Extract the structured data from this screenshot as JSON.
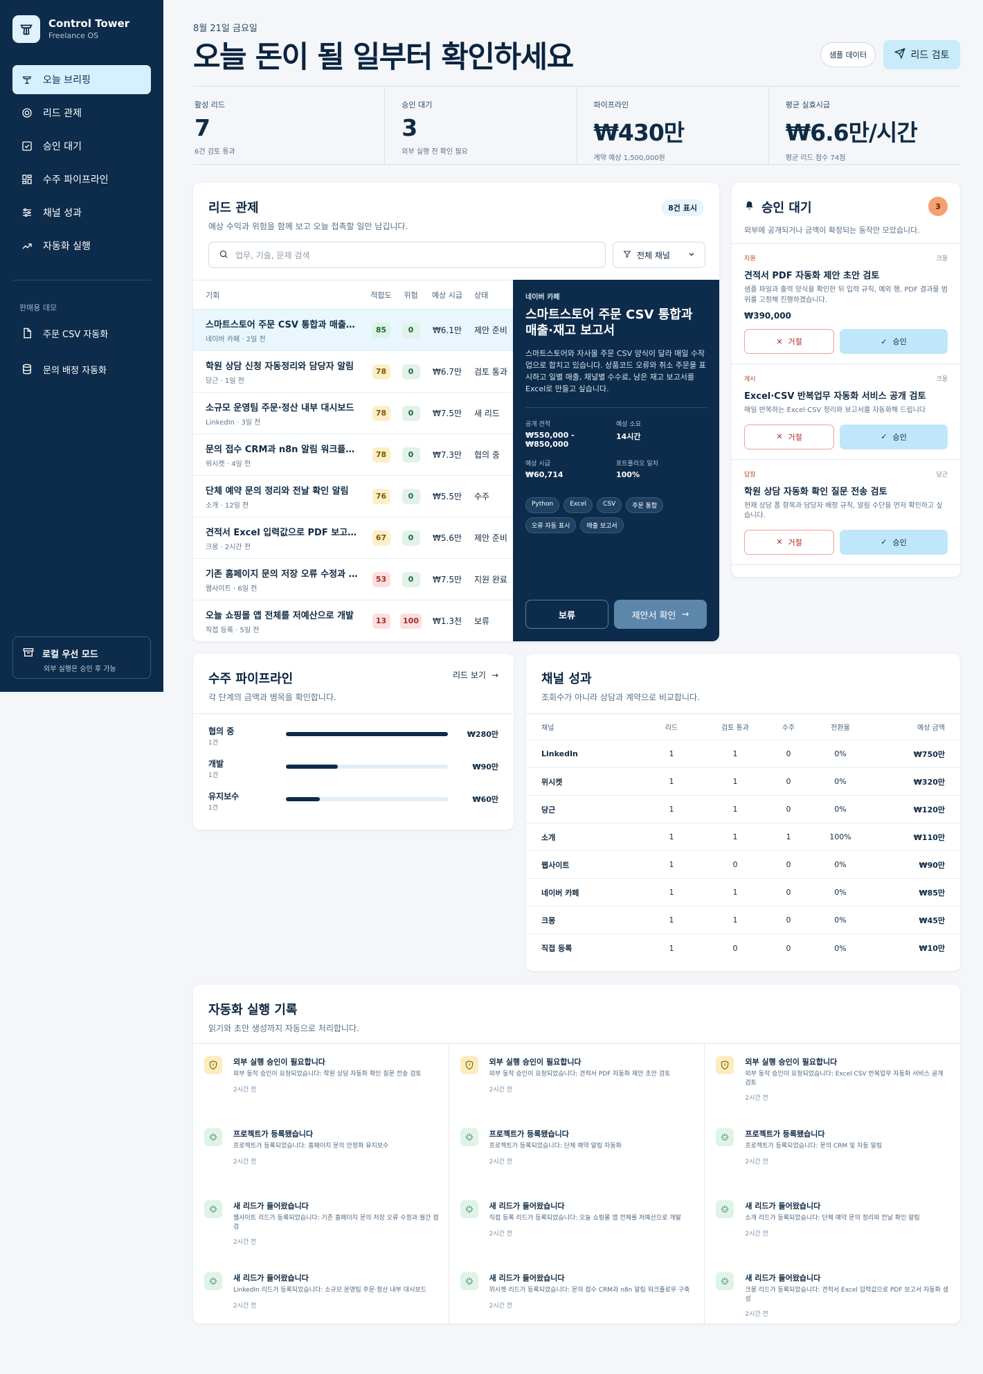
{
  "brand": {
    "title": "Control Tower",
    "subtitle": "Freelance OS"
  },
  "nav": [
    {
      "label": "오늘 브리핑",
      "icon": "tower-icon",
      "active": true
    },
    {
      "label": "리드 관제",
      "icon": "target-icon"
    },
    {
      "label": "승인 대기",
      "icon": "check-square-icon"
    },
    {
      "label": "수주 파이프라인",
      "icon": "kanban-icon"
    },
    {
      "label": "채널 성과",
      "icon": "sliders-icon"
    },
    {
      "label": "자동화 실행",
      "icon": "trend-icon"
    }
  ],
  "demo_section": "판매용 데모",
  "demo_items": [
    {
      "label": "주문 CSV 자동화",
      "icon": "file-icon"
    },
    {
      "label": "문의 배정 자동화",
      "icon": "database-icon"
    }
  ],
  "local_mode": {
    "title": "로컬 우선 모드",
    "subtitle": "외부 실행은 승인 후 가능"
  },
  "header": {
    "date": "8월 21일 금요일",
    "headline": "오늘 돈이 될 일부터 확인하세요",
    "sample_button": "샘플 데이터",
    "review_button": "리드 검토"
  },
  "stats": [
    {
      "label": "활성 리드",
      "value": "7",
      "sub": "6건 검토 통과"
    },
    {
      "label": "승인 대기",
      "value": "3",
      "sub": "외부 실행 전 확인 필요"
    },
    {
      "label": "파이프라인",
      "value": "₩430만",
      "sub": "계약 예상 1,500,000원"
    },
    {
      "label": "평균 실효시급",
      "value": "₩6.6만/시간",
      "sub": "평균 리드 점수 74점"
    }
  ],
  "leads": {
    "title": "리드 관제",
    "subtitle": "예상 수익과 위험을 함께 보고 오늘 접촉할 일만 남깁니다.",
    "count_badge": "8건 표시",
    "search_placeholder": "업무, 기술, 문제 검색",
    "filter_label": "전체 채널",
    "columns": [
      "기회",
      "적합도",
      "위험",
      "예상 시급",
      "상태"
    ],
    "rows": [
      {
        "title": "스마트스토어 주문 CSV 통합과 매출·재고 보고서",
        "meta": "네이버 카페 · 2일 전",
        "fit": "85",
        "fit_class": "p-green",
        "risk": "0",
        "risk_class": "p-zero",
        "rate": "₩6.1만",
        "status": "제안 준비",
        "selected": true
      },
      {
        "title": "학원 상담 신청 자동정리와 담당자 알림",
        "meta": "당근 · 1일 전",
        "fit": "78",
        "fit_class": "p-yellow",
        "risk": "0",
        "risk_class": "p-zero",
        "rate": "₩6.7만",
        "status": "검토 통과"
      },
      {
        "title": "소규모 운영팀 주문·정산 내부 대시보드",
        "meta": "LinkedIn · 3일 전",
        "fit": "78",
        "fit_class": "p-yellow",
        "risk": "0",
        "risk_class": "p-zero",
        "rate": "₩7.5만",
        "status": "새 리드"
      },
      {
        "title": "문의 접수 CRM과 n8n 알림 워크플로우",
        "meta": "위시켓 · 4일 전",
        "fit": "78",
        "fit_class": "p-yellow",
        "risk": "0",
        "risk_class": "p-zero",
        "rate": "₩7.3만",
        "status": "협의 중"
      },
      {
        "title": "단체 예약 문의 정리와 전날 확인 알림",
        "meta": "소개 · 12일 전",
        "fit": "76",
        "fit_class": "p-yellow",
        "risk": "0",
        "risk_class": "p-zero",
        "rate": "₩5.5만",
        "status": "수주"
      },
      {
        "title": "견적서 Excel 입력값으로 PDF 보고서 자동화",
        "meta": "크몽 · 2시간 전",
        "fit": "67",
        "fit_class": "p-yellow",
        "risk": "0",
        "risk_class": "p-zero",
        "rate": "₩5.6만",
        "status": "제안 준비"
      },
      {
        "title": "기존 홈페이지 문의 저장 오류 수정과 월간 점검",
        "meta": "웹사이트 · 6일 전",
        "fit": "53",
        "fit_class": "p-red",
        "risk": "0",
        "risk_class": "p-zero",
        "rate": "₩7.5만",
        "status": "지원 완료"
      },
      {
        "title": "오늘 쇼핑몰 앱 전체를 저예산으로 개발",
        "meta": "직접 등록 · 5일 전",
        "fit": "13",
        "fit_class": "p-red",
        "risk": "100",
        "risk_class": "p-red",
        "rate": "₩1.3천",
        "status": "보류"
      }
    ],
    "detail": {
      "source": "네이버 카페",
      "title": "스마트스토어 주문 CSV 통합과 매출·재고 보고서",
      "description": "스마트스토어와 자사몰 주문 CSV 양식이 달라 매일 수작업으로 합치고 있습니다. 상품코드 오류와 취소 주문을 표시하고 일별 매출, 채널별 수수료, 남은 재고 보고서를 Excel로 만들고 싶습니다.",
      "fields": [
        {
          "k": "공개 견적",
          "v": "₩550,000 - ₩850,000"
        },
        {
          "k": "예상 소요",
          "v": "14시간"
        },
        {
          "k": "예상 시급",
          "v": "₩60,714"
        },
        {
          "k": "포트폴리오 일치",
          "v": "100%"
        }
      ],
      "tags": [
        "Python",
        "Excel",
        "CSV",
        "주문 통합",
        "오류 자동 표시",
        "매출 보고서"
      ],
      "hold_button": "보류",
      "proposal_button": "제안서 확인"
    }
  },
  "approvals": {
    "title": "승인 대기",
    "count": "3",
    "subtitle": "외부에 공개되거나 금액이 확정되는 동작만 모았습니다.",
    "items": [
      {
        "tag": "지원",
        "source": "크몽",
        "title": "견적서 PDF 자동화 제안 초안 검토",
        "desc": "샘플 파일과 출력 양식을 확인한 뒤 입력 규칙, 예외 행, PDF 결과물 범위를 고정해 진행하겠습니다.",
        "price": "₩390,000",
        "reject": "거절",
        "approve": "승인"
      },
      {
        "tag": "게시",
        "source": "크몽",
        "title": "Excel·CSV 반복업무 자동화 서비스 공개 검토",
        "desc": "매일 반복하는 Excel·CSV 정리와 보고서를 자동화해 드립니다",
        "price": "",
        "reject": "거절",
        "approve": "승인"
      },
      {
        "tag": "답장",
        "source": "당근",
        "title": "학원 상담 자동화 확인 질문 전송 검토",
        "desc": "현재 상담 폼 항목과 담당자 배정 규칙, 알림 수단을 먼저 확인하고 싶습니다.",
        "price": "",
        "reject": "거절",
        "approve": "승인"
      }
    ]
  },
  "pipeline": {
    "title": "수주 파이프라인",
    "subtitle": "각 단계의 금액과 병목을 확인합니다.",
    "link": "리드 보기",
    "stages": [
      {
        "name": "협의 중",
        "count": "1건",
        "amount": "₩280만",
        "fraction": 1.0
      },
      {
        "name": "개발",
        "count": "1건",
        "amount": "₩90만",
        "fraction": 0.32
      },
      {
        "name": "유지보수",
        "count": "1건",
        "amount": "₩60만",
        "fraction": 0.21
      }
    ]
  },
  "channels": {
    "title": "채널 성과",
    "subtitle": "조회수가 아니라 상담과 계약으로 비교합니다.",
    "columns": [
      "채널",
      "리드",
      "검토 통과",
      "수주",
      "전환율",
      "예상 금액"
    ],
    "rows": [
      [
        "LinkedIn",
        "1",
        "1",
        "0",
        "0%",
        "₩750만"
      ],
      [
        "위시켓",
        "1",
        "1",
        "0",
        "0%",
        "₩320만"
      ],
      [
        "당근",
        "1",
        "1",
        "0",
        "0%",
        "₩120만"
      ],
      [
        "소개",
        "1",
        "1",
        "1",
        "100%",
        "₩110만"
      ],
      [
        "웹사이트",
        "1",
        "0",
        "0",
        "0%",
        "₩90만"
      ],
      [
        "네이버 카페",
        "1",
        "1",
        "0",
        "0%",
        "₩85만"
      ],
      [
        "크몽",
        "1",
        "1",
        "0",
        "0%",
        "₩45만"
      ],
      [
        "직접 등록",
        "1",
        "0",
        "0",
        "0%",
        "₩10만"
      ]
    ]
  },
  "automation": {
    "title": "자동화 실행 기록",
    "subtitle": "읽기와 초안 생성까지 자동으로 처리합니다.",
    "columns": [
      [
        {
          "type": "warn",
          "title": "외부 실행 승인이 필요합니다",
          "desc": "외부 동작 승인이 요청되었습니다: 학원 상담 자동화 확인 질문 전송 검토",
          "time": "2시간 전"
        },
        {
          "type": "green",
          "title": "프로젝트가 등록됐습니다",
          "desc": "프로젝트가 등록되었습니다: 홈페이지 문의 안정화 유지보수",
          "time": "2시간 전"
        },
        {
          "type": "green",
          "title": "새 리드가 들어왔습니다",
          "desc": "웹사이트 리드가 등록되었습니다: 기존 홈페이지 문의 저장 오류 수정과 월간 점검",
          "time": "2시간 전"
        },
        {
          "type": "green",
          "title": "새 리드가 들어왔습니다",
          "desc": "LinkedIn 리드가 등록되었습니다: 소규모 운영팀 주문·정산 내부 대시보드",
          "time": "2시간 전"
        }
      ],
      [
        {
          "type": "warn",
          "title": "외부 실행 승인이 필요합니다",
          "desc": "외부 동작 승인이 요청되었습니다: 견적서 PDF 자동화 제안 초안 검토",
          "time": "2시간 전"
        },
        {
          "type": "green",
          "title": "프로젝트가 등록됐습니다",
          "desc": "프로젝트가 등록되었습니다: 단체 예약 알림 자동화",
          "time": "2시간 전"
        },
        {
          "type": "green",
          "title": "새 리드가 들어왔습니다",
          "desc": "직접 등록 리드가 등록되었습니다: 오늘 쇼핑몰 앱 전체를 저예산으로 개발",
          "time": "2시간 전"
        },
        {
          "type": "green",
          "title": "새 리드가 들어왔습니다",
          "desc": "위시켓 리드가 등록되었습니다: 문의 접수 CRM과 n8n 알림 워크플로우 구축",
          "time": "2시간 전"
        }
      ],
      [
        {
          "type": "warn",
          "title": "외부 실행 승인이 필요합니다",
          "desc": "외부 동작 승인이 요청되었습니다: Excel·CSV 반복업무 자동화 서비스 공개 검토",
          "time": "2시간 전"
        },
        {
          "type": "green",
          "title": "프로젝트가 등록됐습니다",
          "desc": "프로젝트가 등록되었습니다: 문의 CRM 및 자동 알림",
          "time": "2시간 전"
        },
        {
          "type": "green",
          "title": "새 리드가 들어왔습니다",
          "desc": "소개 리드가 등록되었습니다: 단체 예약 문의 정리와 전날 확인 알림",
          "time": "2시간 전"
        },
        {
          "type": "green",
          "title": "새 리드가 들어왔습니다",
          "desc": "크몽 리드가 등록되었습니다: 견적서 Excel 입력값으로 PDF 보고서 자동화 생성",
          "time": "2시간 전"
        }
      ]
    ]
  }
}
